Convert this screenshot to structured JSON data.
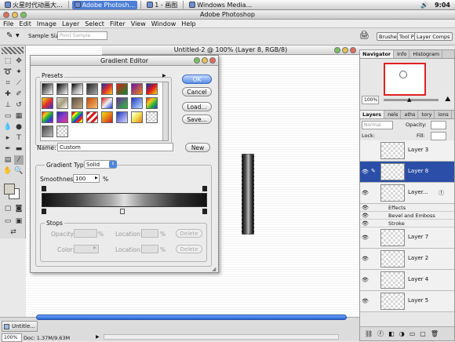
{
  "taskbar": {
    "items": [
      "火星时代动画大...",
      "Adobe Photosh...",
      "1 - 画图",
      "Windows Media..."
    ],
    "clock": "9:04"
  },
  "app": {
    "title": "Adobe Photoshop"
  },
  "menu": [
    "File",
    "Edit",
    "Image",
    "Layer",
    "Select",
    "Filter",
    "View",
    "Window",
    "Help"
  ],
  "options": {
    "sample_size_label": "Sample Size:",
    "sample_size_value": "Point Sample",
    "wells": [
      "Brushes",
      "Tool Pr",
      "Layer Comps"
    ]
  },
  "document": {
    "title": "Untitled-2 @ 100% (Layer 8, RGB/8)"
  },
  "gradient_editor": {
    "title": "Gradient Editor",
    "presets_label": "Presets",
    "buttons": {
      "ok": "OK",
      "cancel": "Cancel",
      "load": "Load...",
      "save": "Save...",
      "new": "New"
    },
    "name_label": "Name:",
    "name_value": "Custom",
    "type_label": "Gradient Type:",
    "type_value": "Solid",
    "smooth_label": "Smoothness:",
    "smooth_value": "100",
    "smooth_unit": "%",
    "stops": {
      "label": "Stops",
      "opacity_label": "Opacity:",
      "location_label": "Location:",
      "color_label": "Color:",
      "percent": "%",
      "delete": "Delete"
    }
  },
  "navigator": {
    "tabs": [
      "Navigator",
      "Info",
      "Histogram"
    ],
    "zoom": "100%"
  },
  "layers": {
    "tabs": [
      "Layers",
      "nels",
      "aths",
      "tory",
      "ions"
    ],
    "blend_mode": "Normal",
    "opacity_label": "Opacity:",
    "fill_label": "Fill:",
    "lock_label": "Lock:",
    "rows": [
      "Layer 3",
      "Layer 8",
      "Layer...",
      "Layer 7",
      "Layer 2",
      "Layer 4",
      "Layer 5"
    ],
    "effects": [
      "Effects",
      "Bevel and Emboss",
      "Stroke"
    ]
  },
  "status": {
    "doc_size": "Doc: 1.37M/9.63M",
    "zoom": "100%",
    "mini_title": "Untitle..."
  }
}
